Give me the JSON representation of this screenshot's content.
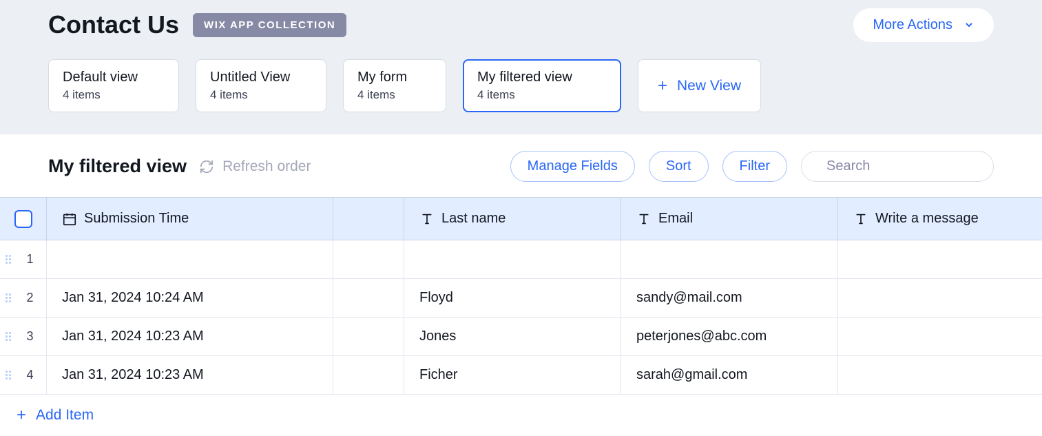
{
  "header": {
    "title": "Contact Us",
    "badge": "WIX APP COLLECTION",
    "moreActions": "More Actions"
  },
  "tabs": [
    {
      "label": "Default view",
      "sub": "4 items"
    },
    {
      "label": "Untitled View",
      "sub": "4 items"
    },
    {
      "label": "My form",
      "sub": "4 items"
    },
    {
      "label": "My filtered view",
      "sub": "4 items"
    }
  ],
  "newViewLabel": "New View",
  "toolbar": {
    "heading": "My filtered view",
    "refreshLabel": "Refresh order",
    "manageFields": "Manage Fields",
    "sort": "Sort",
    "filter": "Filter",
    "searchPlaceholder": "Search"
  },
  "columns": {
    "submissionTime": "Submission Time",
    "lastName": "Last name",
    "email": "Email",
    "message": "Write a message"
  },
  "rows": [
    {
      "num": "1",
      "time": "",
      "lastName": "",
      "email": "",
      "message": ""
    },
    {
      "num": "2",
      "time": "Jan 31, 2024 10:24 AM",
      "lastName": "Floyd",
      "email": "sandy@mail.com",
      "message": ""
    },
    {
      "num": "3",
      "time": "Jan 31, 2024 10:23 AM",
      "lastName": "Jones",
      "email": "peterjones@abc.com",
      "message": ""
    },
    {
      "num": "4",
      "time": "Jan 31, 2024 10:23 AM",
      "lastName": "Ficher",
      "email": "sarah@gmail.com",
      "message": ""
    }
  ],
  "addItemLabel": "Add Item"
}
